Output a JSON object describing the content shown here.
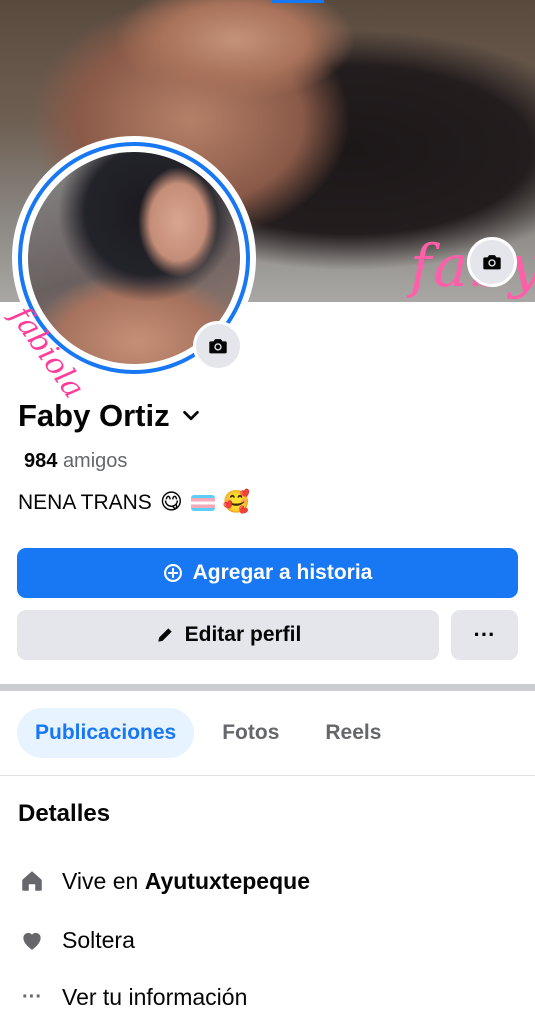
{
  "profile": {
    "name": "Faby Ortiz",
    "friends_count": "984",
    "friends_label": "amigos",
    "bio_text": "NENA TRANS",
    "bio_emoji_1": "😋",
    "bio_emoji_2": "🥰",
    "cover_watermark": "faby",
    "avatar_watermark": "fabiola"
  },
  "actions": {
    "add_story": "Agregar a historia",
    "edit_profile": "Editar perfil",
    "more": "···"
  },
  "tabs": [
    {
      "label": "Publicaciones",
      "active": true
    },
    {
      "label": "Fotos",
      "active": false
    },
    {
      "label": "Reels",
      "active": false
    }
  ],
  "details": {
    "title": "Detalles",
    "lives_prefix": "Vive en",
    "lives_place": "Ayutuxtepeque",
    "relationship": "Soltera",
    "see_info": "Ver tu información",
    "see_info_icon": "···"
  },
  "colors": {
    "primary": "#1877f2",
    "secondary_bg": "#e4e6eb",
    "active_tab_bg": "#e7f3ff",
    "muted_text": "#65676b"
  },
  "icons": {
    "cover_camera": "camera-icon",
    "avatar_camera": "camera-icon",
    "name_chevron": "chevron-down-icon",
    "add_story": "plus-circle-icon",
    "edit": "pencil-icon",
    "home": "home-icon",
    "heart": "heart-icon",
    "more": "more-dots-icon"
  }
}
